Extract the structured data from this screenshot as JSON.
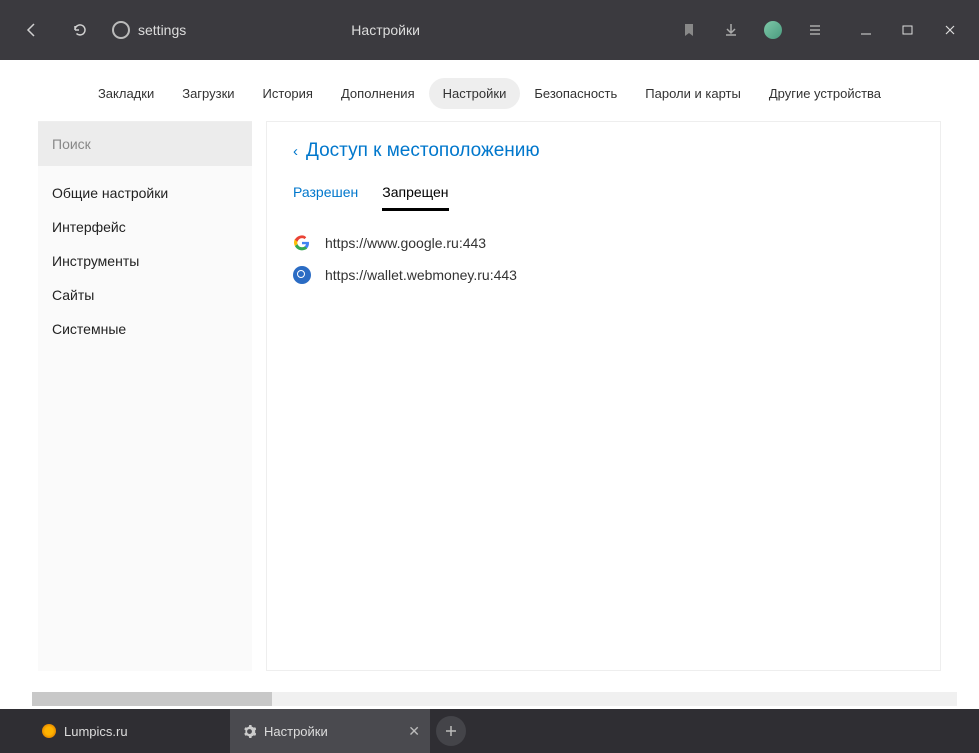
{
  "titlebar": {
    "address_text": "settings",
    "page_title": "Настройки"
  },
  "topnav": {
    "items": [
      {
        "label": "Закладки"
      },
      {
        "label": "Загрузки"
      },
      {
        "label": "История"
      },
      {
        "label": "Дополнения"
      },
      {
        "label": "Настройки",
        "active": true
      },
      {
        "label": "Безопасность"
      },
      {
        "label": "Пароли и карты"
      },
      {
        "label": "Другие устройства"
      }
    ]
  },
  "sidebar": {
    "search_placeholder": "Поиск",
    "items": [
      {
        "label": "Общие настройки"
      },
      {
        "label": "Интерфейс"
      },
      {
        "label": "Инструменты"
      },
      {
        "label": "Сайты"
      },
      {
        "label": "Системные"
      }
    ]
  },
  "main": {
    "section_title": "Доступ к местоположению",
    "tabs": {
      "allowed": "Разрешен",
      "denied": "Запрещен"
    },
    "sites": [
      {
        "icon": "google",
        "url": "https://www.google.ru:443"
      },
      {
        "icon": "webmoney",
        "url": "https://wallet.webmoney.ru:443"
      }
    ]
  },
  "tabstrip": {
    "tabs": [
      {
        "icon": "lumpics",
        "label": "Lumpics.ru"
      },
      {
        "icon": "gear",
        "label": "Настройки",
        "active": true
      }
    ]
  }
}
